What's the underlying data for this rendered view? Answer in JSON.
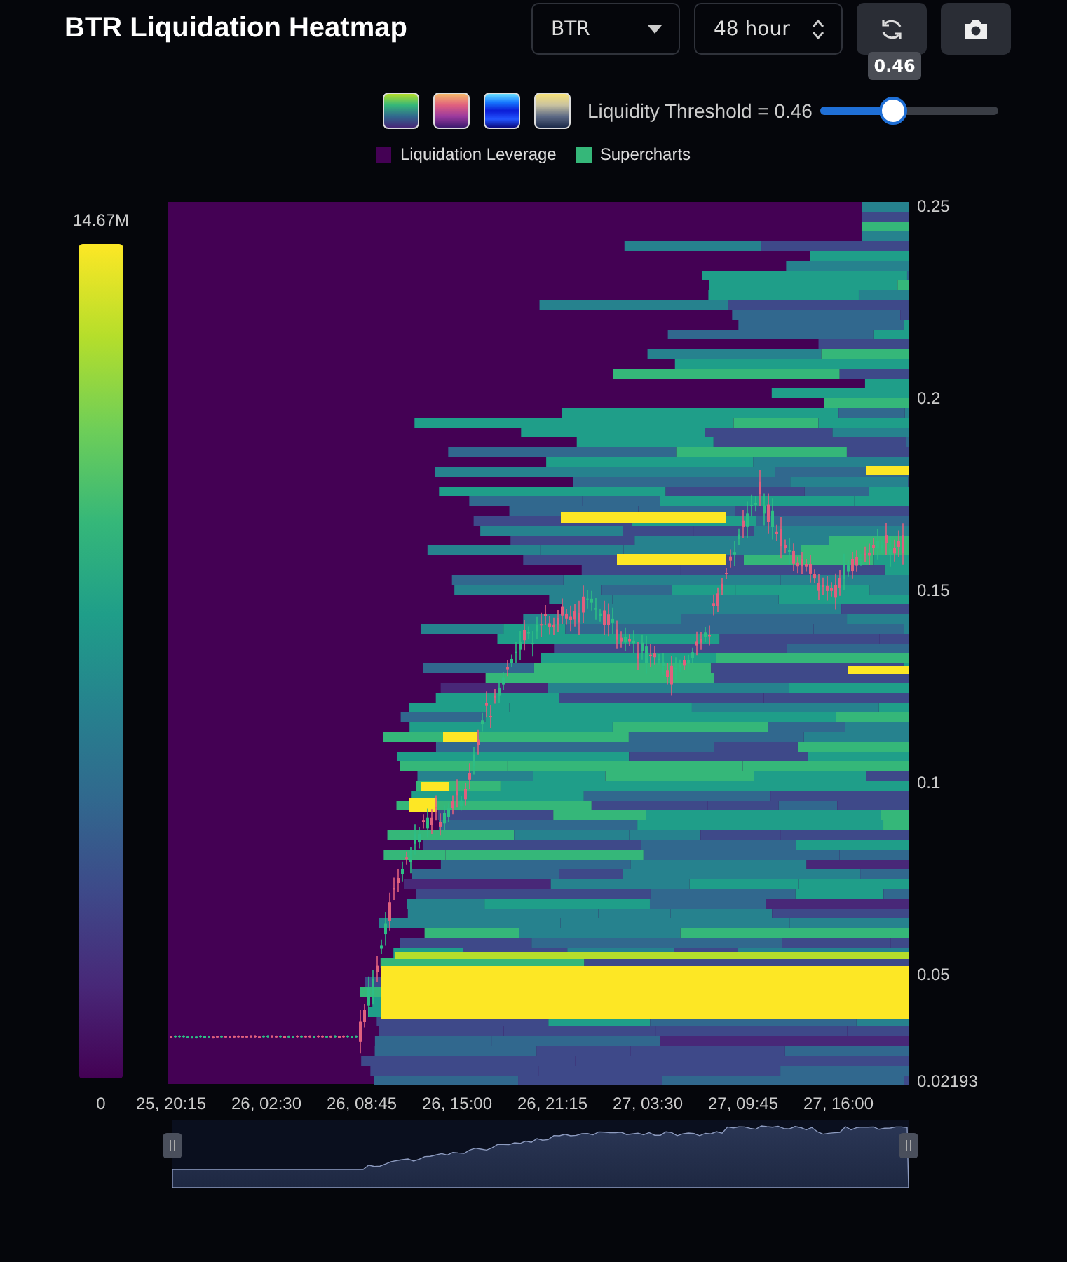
{
  "header": {
    "title": "BTR Liquidation Heatmap",
    "symbol_select": {
      "value": "BTR"
    },
    "period_select": {
      "value": "48 hour"
    }
  },
  "threshold": {
    "label": "Liquidity Threshold = 0.46",
    "tooltip": "0.46",
    "level": 0.4
  },
  "legend": [
    {
      "label": "Liquidation Leverage",
      "color": "#440154"
    },
    {
      "label": "Supercharts",
      "color": "#35b779"
    }
  ],
  "color_scale": {
    "max": "14.67M",
    "min": "0"
  },
  "y_axis": [
    "0.25",
    "0.2",
    "0.15",
    "0.1",
    "0.05",
    "0.02193"
  ],
  "x_axis": [
    "25, 20:15",
    "26, 02:30",
    "26, 08:45",
    "26, 15:00",
    "26, 21:15",
    "27, 03:30",
    "27, 09:45",
    "27, 16:00"
  ]
}
